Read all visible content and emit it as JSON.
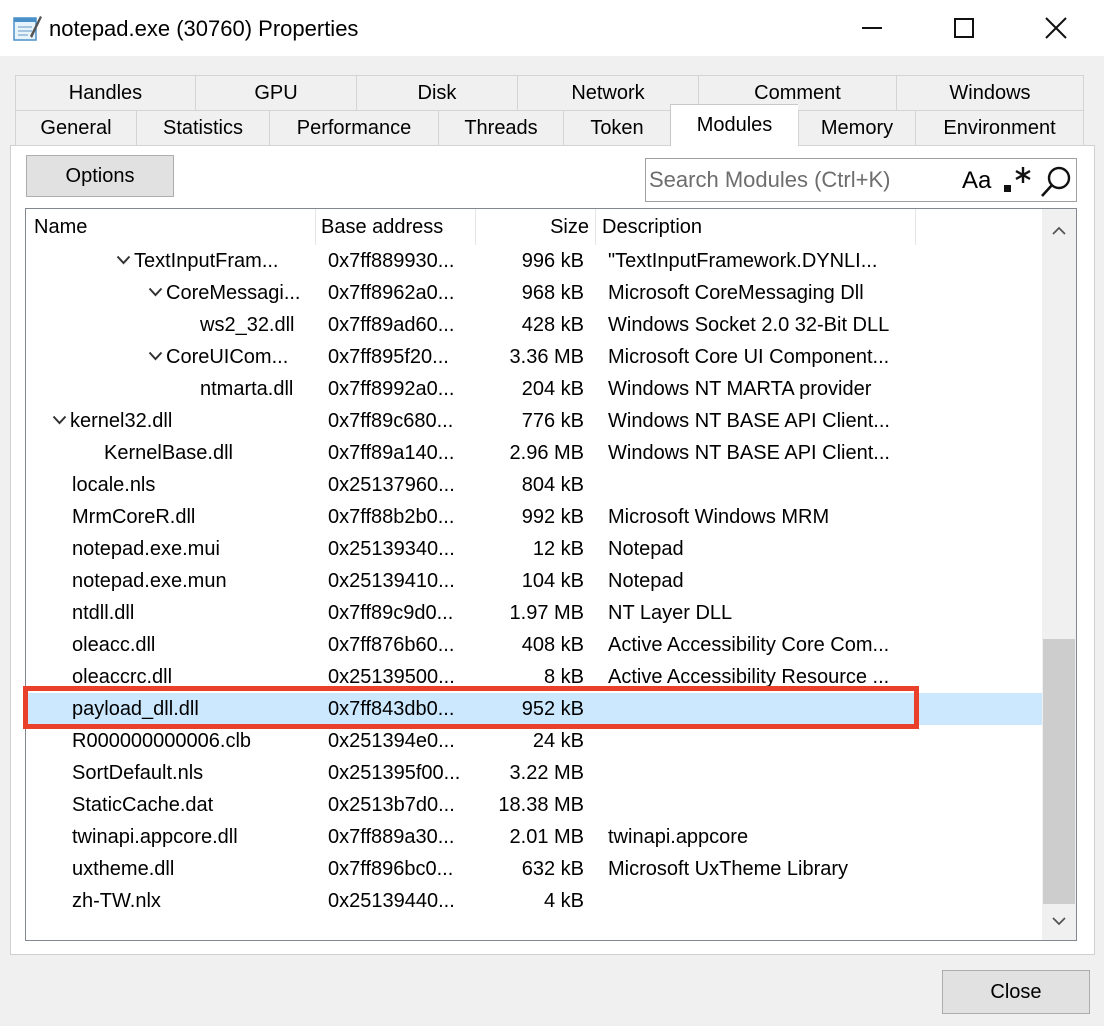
{
  "window": {
    "title": "notepad.exe (30760) Properties"
  },
  "tabs": {
    "back_row": [
      {
        "label": "Handles",
        "width": 180
      },
      {
        "label": "GPU",
        "width": 161
      },
      {
        "label": "Disk",
        "width": 161
      },
      {
        "label": "Network",
        "width": 181
      },
      {
        "label": "Comment",
        "width": 198
      },
      {
        "label": "Windows",
        "width": 188
      }
    ],
    "front_row": [
      {
        "label": "General",
        "width": 121
      },
      {
        "label": "Statistics",
        "width": 133
      },
      {
        "label": "Performance",
        "width": 169
      },
      {
        "label": "Threads",
        "width": 125
      },
      {
        "label": "Token",
        "width": 107
      },
      {
        "label": "Modules",
        "width": 128,
        "active": true
      },
      {
        "label": "Memory",
        "width": 117
      },
      {
        "label": "Environment",
        "width": 169
      }
    ]
  },
  "toolbar": {
    "options_label": "Options",
    "search_placeholder": "Search Modules (Ctrl+K)",
    "case_toggle_label": "Aa"
  },
  "columns": {
    "name": "Name",
    "base": "Base address",
    "size": "Size",
    "desc": "Description"
  },
  "modules": [
    {
      "name": "TextInputFram...",
      "level": 3,
      "expanded": true,
      "base": "0x7ff889930...",
      "size": "996 kB",
      "desc": "\"TextInputFramework.DYNLI..."
    },
    {
      "name": "CoreMessagi...",
      "level": 4,
      "expanded": true,
      "base": "0x7ff8962a0...",
      "size": "968 kB",
      "desc": "Microsoft CoreMessaging Dll"
    },
    {
      "name": "ws2_32.dll",
      "level": 5,
      "expanded": false,
      "base": "0x7ff89ad60...",
      "size": "428 kB",
      "desc": "Windows Socket 2.0 32-Bit DLL"
    },
    {
      "name": "CoreUICom...",
      "level": 4,
      "expanded": true,
      "base": "0x7ff895f20...",
      "size": "3.36 MB",
      "desc": "Microsoft Core UI Component..."
    },
    {
      "name": "ntmarta.dll",
      "level": 5,
      "expanded": false,
      "base": "0x7ff8992a0...",
      "size": "204 kB",
      "desc": "Windows NT MARTA provider"
    },
    {
      "name": "kernel32.dll",
      "level": 1,
      "expanded": true,
      "base": "0x7ff89c680...",
      "size": "776 kB",
      "desc": "Windows NT BASE API Client..."
    },
    {
      "name": "KernelBase.dll",
      "level": 2,
      "expanded": false,
      "base": "0x7ff89a140...",
      "size": "2.96 MB",
      "desc": "Windows NT BASE API Client..."
    },
    {
      "name": "locale.nls",
      "level": 1,
      "expanded": false,
      "base": "0x25137960...",
      "size": "804 kB",
      "desc": ""
    },
    {
      "name": "MrmCoreR.dll",
      "level": 1,
      "expanded": false,
      "base": "0x7ff88b2b0...",
      "size": "992 kB",
      "desc": "Microsoft Windows MRM"
    },
    {
      "name": "notepad.exe.mui",
      "level": 1,
      "expanded": false,
      "base": "0x25139340...",
      "size": "12 kB",
      "desc": "Notepad"
    },
    {
      "name": "notepad.exe.mun",
      "level": 1,
      "expanded": false,
      "base": "0x25139410...",
      "size": "104 kB",
      "desc": "Notepad"
    },
    {
      "name": "ntdll.dll",
      "level": 1,
      "expanded": false,
      "base": "0x7ff89c9d0...",
      "size": "1.97 MB",
      "desc": "NT Layer DLL"
    },
    {
      "name": "oleacc.dll",
      "level": 1,
      "expanded": false,
      "base": "0x7ff876b60...",
      "size": "408 kB",
      "desc": "Active Accessibility Core Com..."
    },
    {
      "name": "oleaccrc.dll",
      "level": 1,
      "expanded": false,
      "base": "0x25139500...",
      "size": "8 kB",
      "desc": "Active Accessibility Resource ..."
    },
    {
      "name": "payload_dll.dll",
      "level": 1,
      "expanded": false,
      "base": "0x7ff843db0...",
      "size": "952 kB",
      "desc": "",
      "selected": true
    },
    {
      "name": "R000000000006.clb",
      "level": 1,
      "expanded": false,
      "base": "0x251394e0...",
      "size": "24 kB",
      "desc": ""
    },
    {
      "name": "SortDefault.nls",
      "level": 1,
      "expanded": false,
      "base": "0x251395f00...",
      "size": "3.22 MB",
      "desc": ""
    },
    {
      "name": "StaticCache.dat",
      "level": 1,
      "expanded": false,
      "base": "0x2513b7d0...",
      "size": "18.38 MB",
      "desc": ""
    },
    {
      "name": "twinapi.appcore.dll",
      "level": 1,
      "expanded": false,
      "base": "0x7ff889a30...",
      "size": "2.01 MB",
      "desc": "twinapi.appcore"
    },
    {
      "name": "uxtheme.dll",
      "level": 1,
      "expanded": false,
      "base": "0x7ff896bc0...",
      "size": "632 kB",
      "desc": "Microsoft UxTheme Library"
    },
    {
      "name": "zh-TW.nlx",
      "level": 1,
      "expanded": false,
      "base": "0x25139440...",
      "size": "4 kB",
      "desc": ""
    }
  ],
  "footer": {
    "close_label": "Close"
  },
  "colors": {
    "selection": "#cce8ff",
    "highlight_border": "#e8402a"
  }
}
